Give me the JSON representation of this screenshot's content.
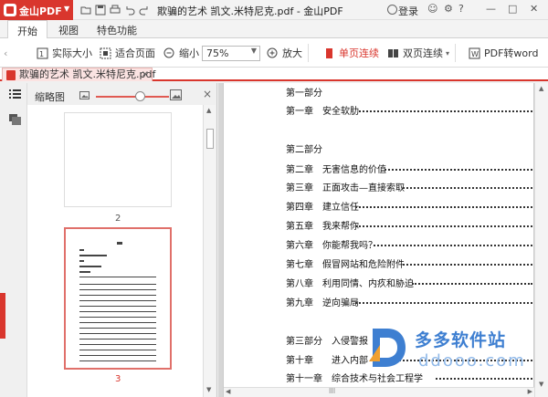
{
  "app": {
    "name": "金山PDF",
    "window_title": "欺骗的艺术 凯文.米特尼克.pdf - 金山PDF",
    "login": "登录"
  },
  "colors": {
    "accent": "#d9362d",
    "watermark": "#3e7fd1"
  },
  "menu": {
    "tabs": [
      "开始",
      "视图",
      "特色功能"
    ],
    "active": "开始"
  },
  "toolbar": {
    "actual_size": "实际大小",
    "fit_page": "适合页面",
    "zoom_out": "缩小",
    "zoom_value": "75%",
    "zoom_in": "放大",
    "single_page": "单页连续",
    "double_page": "双页连续",
    "pdf_to_word": "PDF转word"
  },
  "doc_tab": {
    "label": "欺骗的艺术 凯文.米特尼克.pdf",
    "close": "×"
  },
  "thumbnail_panel": {
    "title": "缩略图",
    "close": "×",
    "pages": [
      {
        "number": "2"
      },
      {
        "number": "3",
        "selected": true
      }
    ]
  },
  "document": {
    "toc": [
      {
        "text": "第一部分"
      },
      {
        "text": "第一章　安全软肋"
      },
      {
        "text": "第二部分"
      },
      {
        "text": "第二章　无害信息的价值"
      },
      {
        "text": "第三章　正面攻击—直接索取"
      },
      {
        "text": "第四章　建立信任"
      },
      {
        "text": "第五章　我来帮你"
      },
      {
        "text": "第六章　你能帮我吗？"
      },
      {
        "text": "第七章　假冒网站和危险附件"
      },
      {
        "text": "第八章　利用同情、内疚和胁迫"
      },
      {
        "text": "第九章　逆向骗局"
      },
      {
        "text": "第三部分　入侵警报"
      },
      {
        "text": "第十章　　进入内部"
      },
      {
        "text": "第十一章　综合技术与社会工程学"
      }
    ]
  },
  "scrollbar": {
    "grip": "III"
  },
  "watermark": {
    "name": "多多软件站",
    "url": "ddooo.com"
  }
}
